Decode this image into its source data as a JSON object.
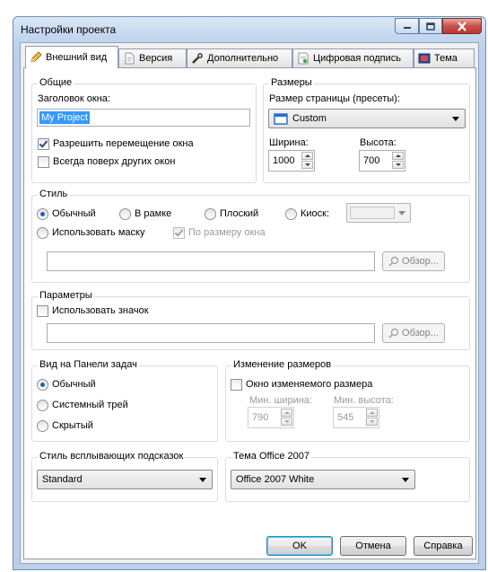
{
  "window": {
    "title": "Настройки проекта"
  },
  "tabs": [
    {
      "label": "Внешний вид",
      "icon": "pencil-icon"
    },
    {
      "label": "Версия",
      "icon": "document-icon"
    },
    {
      "label": "Дополнительно",
      "icon": "tools-icon"
    },
    {
      "label": "Цифровая подпись",
      "icon": "signature-icon"
    },
    {
      "label": "Тема",
      "icon": "theme-icon"
    }
  ],
  "general": {
    "group_label": "Общие",
    "window_title_label": "Заголовок окна:",
    "window_title_value": "My Project",
    "allow_move_label": "Разрешить перемещение окна",
    "always_on_top_label": "Всегда поверх других окон"
  },
  "sizes": {
    "group_label": "Размеры",
    "page_size_label": "Размер страницы (пресеты):",
    "page_size_value": "Custom",
    "width_label": "Ширина:",
    "width_value": "1000",
    "height_label": "Высота:",
    "height_value": "700"
  },
  "style": {
    "group_label": "Стиль",
    "opt_normal": "Обычный",
    "opt_framed": "В рамке",
    "opt_flat": "Плоский",
    "opt_kiosk": "Киоск:",
    "use_mask": "Использовать маску",
    "fit_window": "По размеру окна",
    "browse": "Обзор..."
  },
  "params": {
    "group_label": "Параметры",
    "use_icon": "Использовать значок",
    "browse": "Обзор..."
  },
  "taskbar": {
    "group_label": "Вид на Панели задач",
    "opt_normal": "Обычный",
    "opt_tray": "Системный трей",
    "opt_hidden": "Скрытый"
  },
  "resize": {
    "group_label": "Изменение размеров",
    "resizable_label": "Окно изменяемого размера",
    "min_width_label": "Мин. ширина:",
    "min_width_value": "790",
    "min_height_label": "Мин. высота:",
    "min_height_value": "545"
  },
  "tooltip": {
    "group_label": "Стиль всплывающих подсказок",
    "value": "Standard"
  },
  "office": {
    "group_label": "Тема Office 2007",
    "value": "Office 2007 White"
  },
  "buttons": {
    "ok": "OK",
    "cancel": "Отмена",
    "help": "Справка"
  }
}
